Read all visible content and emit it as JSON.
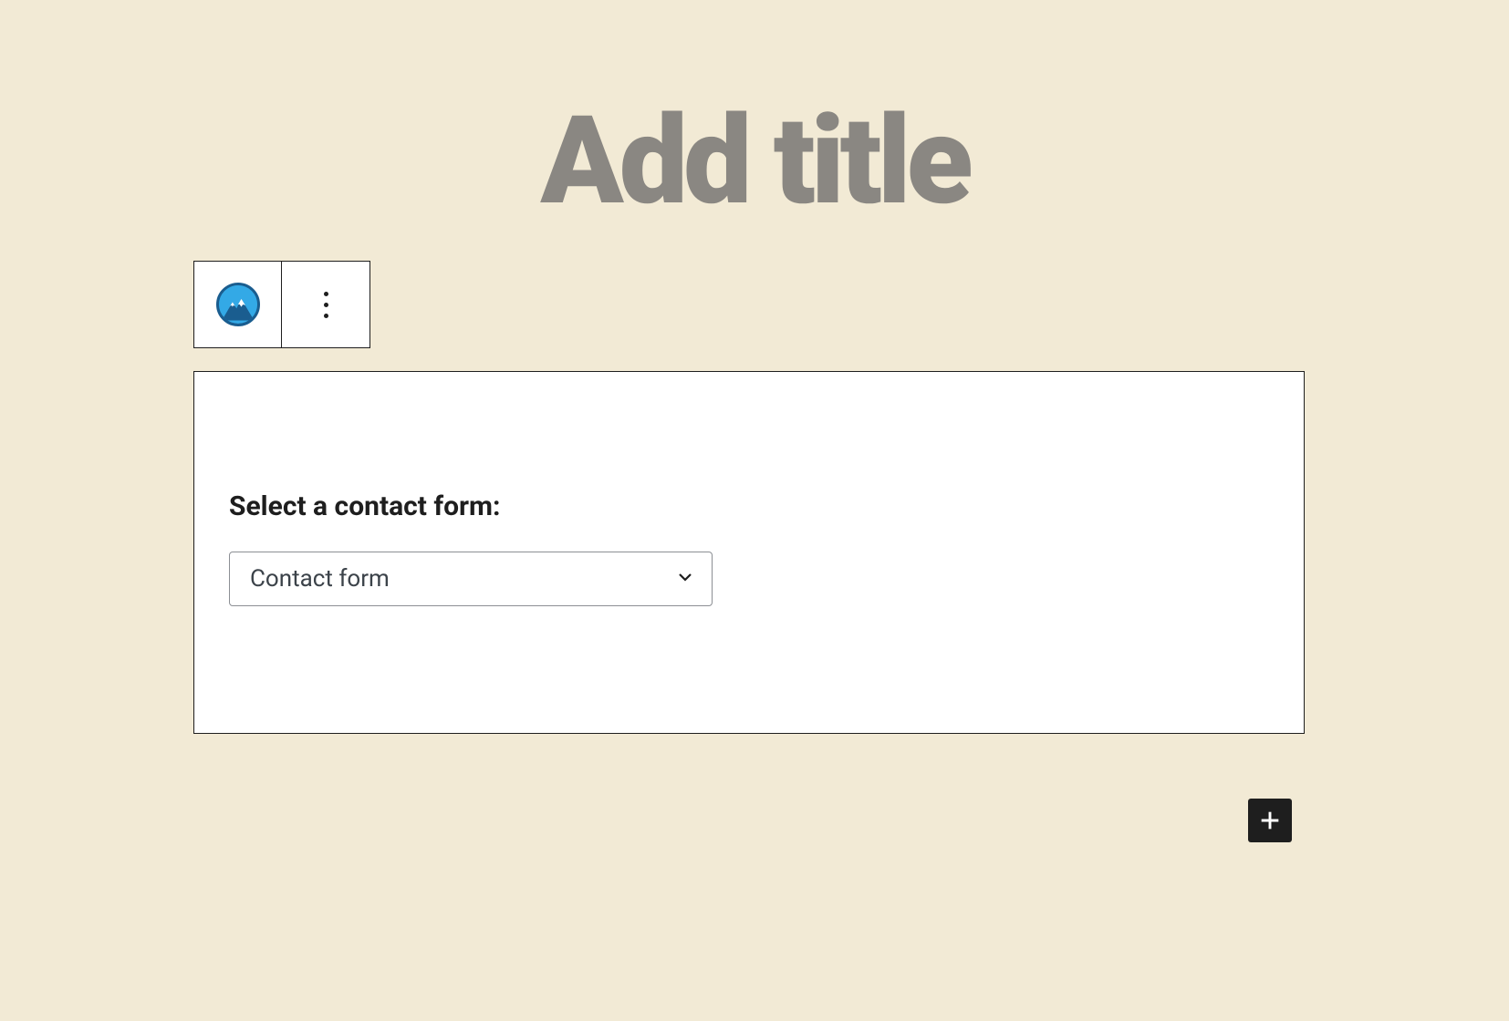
{
  "editor": {
    "title_placeholder": "Add title"
  },
  "block": {
    "label": "Select a contact form:",
    "select": {
      "selected": "Contact form"
    }
  }
}
